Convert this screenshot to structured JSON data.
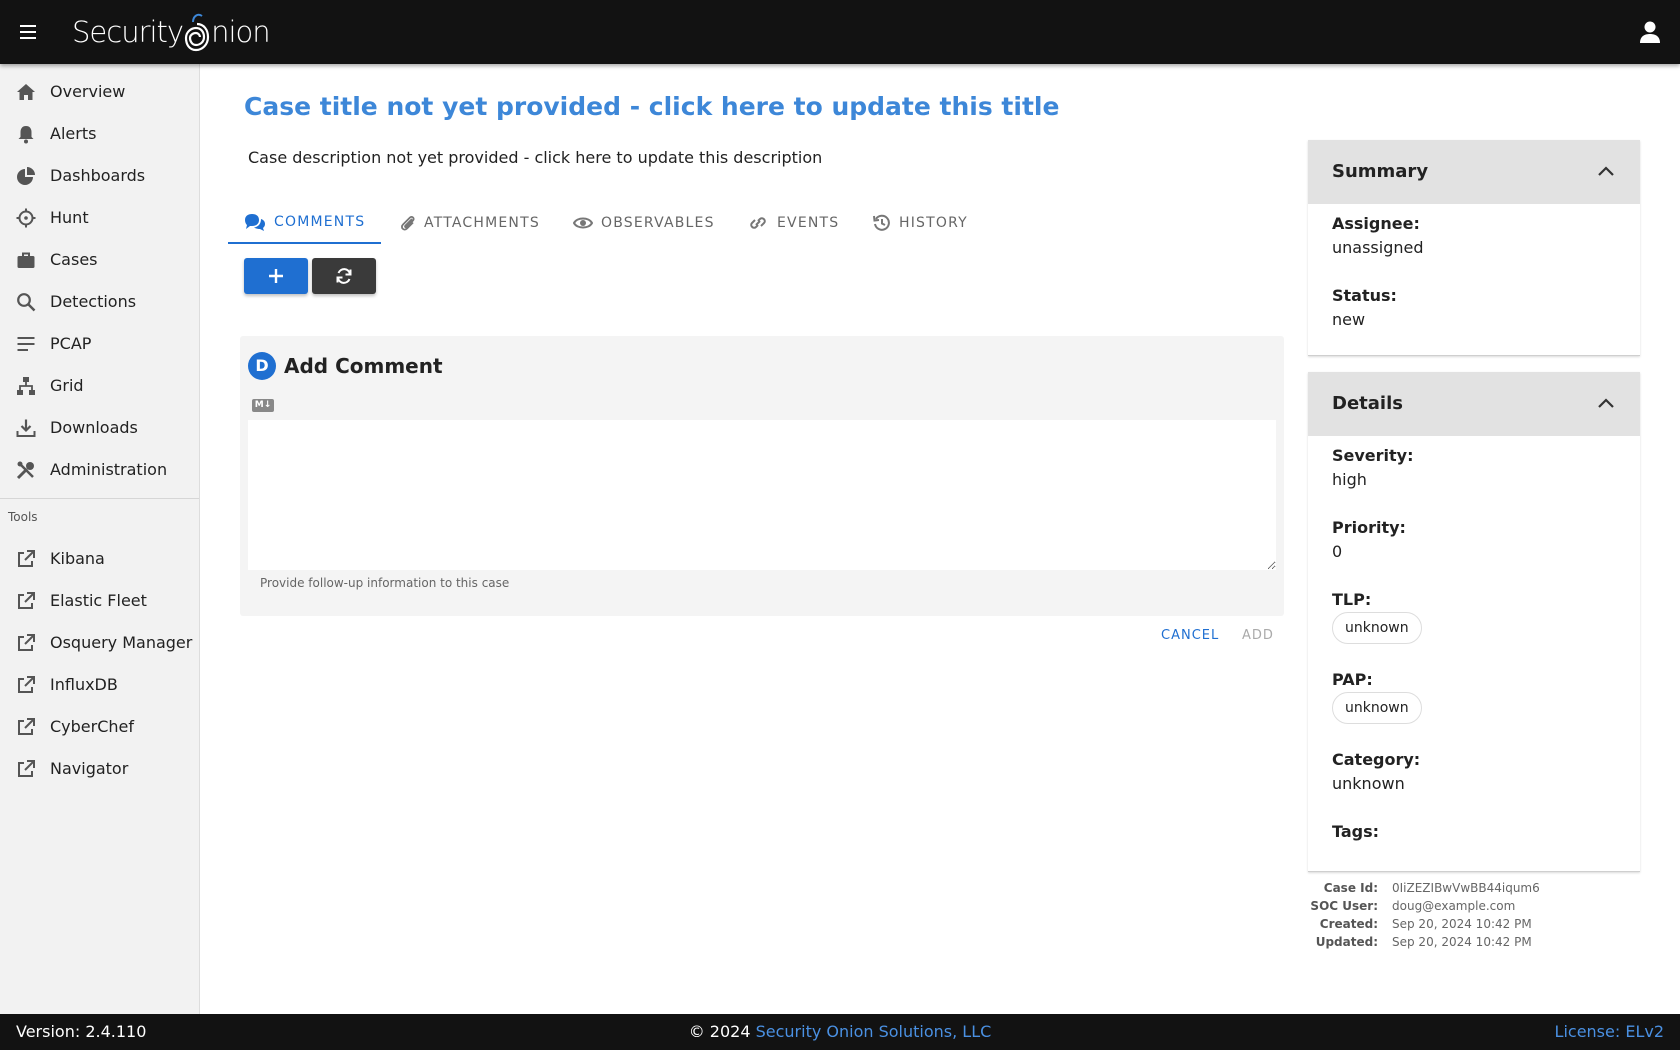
{
  "topbar": {
    "logo_text_left": "Security",
    "logo_text_right": "nion"
  },
  "sidebar": {
    "items": [
      {
        "label": "Overview",
        "icon": "home-icon"
      },
      {
        "label": "Alerts",
        "icon": "bell-icon"
      },
      {
        "label": "Dashboards",
        "icon": "chart-pie-icon"
      },
      {
        "label": "Hunt",
        "icon": "crosshairs-icon"
      },
      {
        "label": "Cases",
        "icon": "briefcase-icon"
      },
      {
        "label": "Detections",
        "icon": "search-icon"
      },
      {
        "label": "PCAP",
        "icon": "list-icon"
      },
      {
        "label": "Grid",
        "icon": "network-icon"
      },
      {
        "label": "Downloads",
        "icon": "download-icon"
      },
      {
        "label": "Administration",
        "icon": "tools-icon"
      }
    ],
    "tools_label": "Tools",
    "tools": [
      {
        "label": "Kibana",
        "icon": "external-link-icon"
      },
      {
        "label": "Elastic Fleet",
        "icon": "external-link-icon"
      },
      {
        "label": "Osquery Manager",
        "icon": "external-link-icon"
      },
      {
        "label": "InfluxDB",
        "icon": "external-link-icon"
      },
      {
        "label": "CyberChef",
        "icon": "external-link-icon"
      },
      {
        "label": "Navigator",
        "icon": "external-link-icon"
      }
    ]
  },
  "main": {
    "title": "Case title not yet provided - click here to update this title",
    "description": "Case description not yet provided - click here to update this description",
    "tabs": [
      {
        "label": "COMMENTS",
        "icon": "comments-icon",
        "active": true
      },
      {
        "label": "ATTACHMENTS",
        "icon": "paperclip-icon",
        "active": false
      },
      {
        "label": "OBSERVABLES",
        "icon": "eye-icon",
        "active": false
      },
      {
        "label": "EVENTS",
        "icon": "link-icon",
        "active": false
      },
      {
        "label": "HISTORY",
        "icon": "history-icon",
        "active": false
      }
    ],
    "comment_form": {
      "avatar_letter": "D",
      "title": "Add Comment",
      "markdown_badge": "M↓",
      "textarea_value": "",
      "hint": "Provide follow-up information to this case",
      "cancel_label": "CANCEL",
      "add_label": "ADD"
    }
  },
  "summary": {
    "title": "Summary",
    "assignee_label": "Assignee:",
    "assignee": "unassigned",
    "status_label": "Status:",
    "status": "new"
  },
  "details": {
    "title": "Details",
    "severity_label": "Severity:",
    "severity": "high",
    "priority_label": "Priority:",
    "priority": "0",
    "tlp_label": "TLP:",
    "tlp": "unknown",
    "pap_label": "PAP:",
    "pap": "unknown",
    "category_label": "Category:",
    "category": "unknown",
    "tags_label": "Tags:"
  },
  "meta": {
    "case_id_label": "Case Id:",
    "case_id": "0IiZEZIBwVwBB44iqum6",
    "soc_user_label": "SOC User:",
    "soc_user": "doug@example.com",
    "created_label": "Created:",
    "created": "Sep 20, 2024 10:42 PM",
    "updated_label": "Updated:",
    "updated": "Sep 20, 2024 10:42 PM"
  },
  "footer": {
    "version": "Version: 2.4.110",
    "copyright_prefix": "© 2024 ",
    "company": "Security Onion Solutions, LLC",
    "license": "License: ELv2"
  },
  "colors": {
    "accent": "#1f6fd1",
    "title_link": "#3d87d8",
    "topbar": "#121212"
  }
}
